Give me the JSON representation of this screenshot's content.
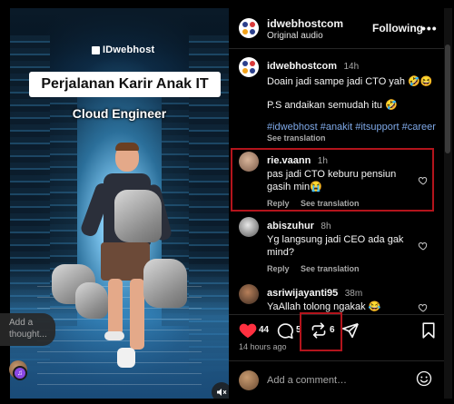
{
  "video": {
    "brand": "IDwebhost",
    "title": "Perjalanan Karir Anak IT",
    "subtitle": "Cloud Engineer",
    "thought_placeholder": "Add a thought..."
  },
  "header": {
    "username": "idwebhostcom",
    "audio": "Original audio",
    "follow_label": "Following",
    "more_label": "•••"
  },
  "caption": {
    "username": "idwebhostcom",
    "time": "14h",
    "line1": "Doain jadi sampe jadi CTO yah 🤣😆",
    "line2": "P.S andaikan semudah itu 🤣",
    "hashtags": "#idwebhost #anakit #itsupport #career",
    "see_translation": "See translation"
  },
  "comments": [
    {
      "username": "rie.vaann",
      "time": "1h",
      "text": "pas jadi CTO keburu pensiun gasih min😭",
      "reply_label": "Reply",
      "translate_label": "See translation"
    },
    {
      "username": "abiszuhur",
      "time": "8h",
      "text": "Yg langsung jadi CEO ada gak mind?",
      "reply_label": "Reply",
      "translate_label": "See translation"
    },
    {
      "username": "asriwijayanti95",
      "time": "38m",
      "text": "YaAllah tolong ngakak 😂",
      "reply_label": "",
      "translate_label": ""
    }
  ],
  "actions": {
    "likes": "44",
    "comments": "5",
    "reposts": "6",
    "posted": "14 hours ago"
  },
  "composer": {
    "placeholder": "Add a comment…"
  },
  "colors": {
    "like_red": "#ff3040",
    "highlight_red": "#b3141c",
    "hashtag_blue": "#7fa9e8",
    "music_badge_purple": "#8a48e6"
  },
  "icons": {
    "like": "heart-filled-icon",
    "comment": "speech-bubble-icon",
    "repost": "repost-arrows-icon",
    "share": "paper-plane-icon",
    "save": "bookmark-icon",
    "emoji": "smiley-icon",
    "mute": "speaker-muted-icon",
    "more": "more-horizontal-icon",
    "music": "music-note-icon"
  }
}
